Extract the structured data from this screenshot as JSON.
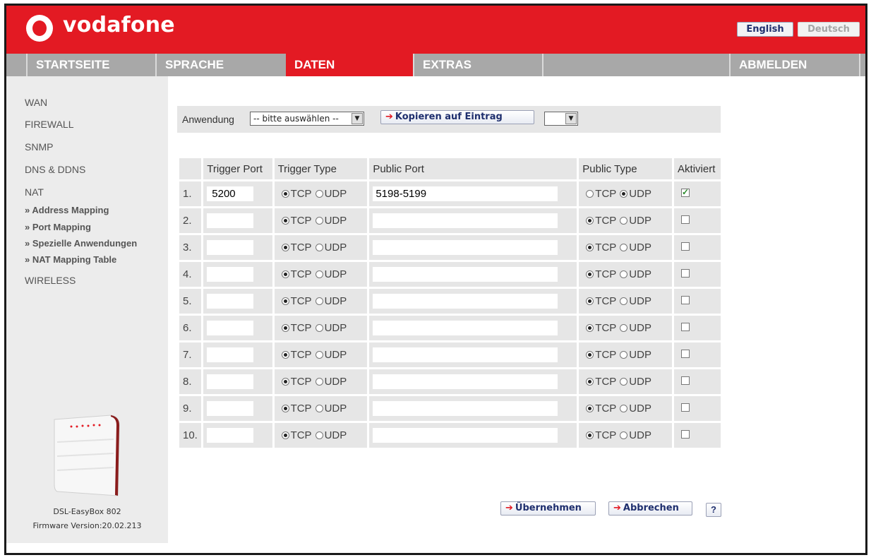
{
  "brand": {
    "name": "vodafone"
  },
  "language": {
    "english": "English",
    "deutsch": "Deutsch"
  },
  "nav": {
    "items": [
      "STARTSEITE",
      "SPRACHE",
      "DATEN",
      "EXTRAS"
    ],
    "logout": "ABMELDEN"
  },
  "sidebar": {
    "wan": "WAN",
    "firewall": "FIREWALL",
    "snmp": "SNMP",
    "dns": "DNS & DDNS",
    "nat": "NAT",
    "sub": [
      "» Address Mapping",
      "» Port Mapping",
      "» Spezielle Anwendungen",
      "» NAT Mapping Table"
    ],
    "wireless": "WIRELESS",
    "device_name": "DSL-EasyBox 802",
    "firmware": "Firmware Version:20.02.213"
  },
  "form": {
    "anwendung_label": "Anwendung",
    "anwendung_value": "-- bitte auswählen --",
    "copy_button": "Kopieren auf Eintrag",
    "entry_value": ""
  },
  "table": {
    "headers": [
      "",
      "Trigger Port",
      "Trigger Type",
      "Public Port",
      "Public Type",
      "Aktiviert"
    ],
    "tcp": "TCP",
    "udp": "UDP",
    "rows": [
      {
        "num": "1.",
        "trigger_port": "5200",
        "trigger_type": "TCP",
        "public_port": "5198-5199",
        "public_type": "UDP",
        "enabled": true
      },
      {
        "num": "2.",
        "trigger_port": "",
        "trigger_type": "TCP",
        "public_port": "",
        "public_type": "TCP",
        "enabled": false
      },
      {
        "num": "3.",
        "trigger_port": "",
        "trigger_type": "TCP",
        "public_port": "",
        "public_type": "TCP",
        "enabled": false
      },
      {
        "num": "4.",
        "trigger_port": "",
        "trigger_type": "TCP",
        "public_port": "",
        "public_type": "TCP",
        "enabled": false
      },
      {
        "num": "5.",
        "trigger_port": "",
        "trigger_type": "TCP",
        "public_port": "",
        "public_type": "TCP",
        "enabled": false
      },
      {
        "num": "6.",
        "trigger_port": "",
        "trigger_type": "TCP",
        "public_port": "",
        "public_type": "TCP",
        "enabled": false
      },
      {
        "num": "7.",
        "trigger_port": "",
        "trigger_type": "TCP",
        "public_port": "",
        "public_type": "TCP",
        "enabled": false
      },
      {
        "num": "8.",
        "trigger_port": "",
        "trigger_type": "TCP",
        "public_port": "",
        "public_type": "TCP",
        "enabled": false
      },
      {
        "num": "9.",
        "trigger_port": "",
        "trigger_type": "TCP",
        "public_port": "",
        "public_type": "TCP",
        "enabled": false
      },
      {
        "num": "10.",
        "trigger_port": "",
        "trigger_type": "TCP",
        "public_port": "",
        "public_type": "TCP",
        "enabled": false
      }
    ]
  },
  "actions": {
    "apply": "Übernehmen",
    "cancel": "Abbrechen",
    "help": "?"
  },
  "colors": {
    "brand_red": "#e31a23",
    "nav_gray": "#a8a8a8",
    "button_text": "#1f2f6e"
  },
  "icons": {
    "logo": "vodafone-speechmark-icon",
    "arrow": "red-arrow-icon",
    "dropdown": "dropdown-arrow-icon"
  }
}
